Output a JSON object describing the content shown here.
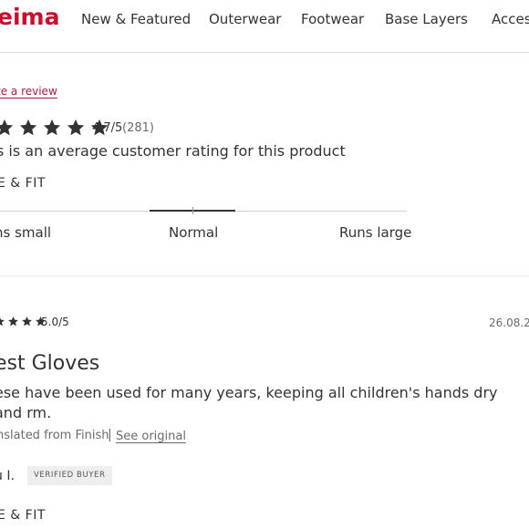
{
  "header": {
    "logo_text": "eima",
    "nav": [
      "New & Featured",
      "Outerwear",
      "Footwear",
      "Base Layers",
      "Acces"
    ]
  },
  "reviews_summary": {
    "write_review": "te a review",
    "rating_value": "4.7/5",
    "rating_count": "(281)",
    "rating_description": "s is an average customer rating for this product",
    "stars_filled": 5,
    "size_fit_title": "E & FIT",
    "fit_labels": {
      "small": "ns small",
      "normal": "Normal",
      "large": "Runs large"
    },
    "fit_position": 0.5
  },
  "review": {
    "score": "5.0/5",
    "date": "26.08.2",
    "title": "est Gloves",
    "body": "ese have been used for many years, keeping all children's hands dry and rm.",
    "translated": "nslated from Finish",
    "separator": "|",
    "see_original": "See original",
    "author": "u I.",
    "verified_badge": "VERIFIED BUYER",
    "size_fit_title": "E & FIT"
  },
  "colors": {
    "brand": "#c8102e",
    "link": "#b01a3a",
    "text": "#333333",
    "star": "#333333"
  }
}
